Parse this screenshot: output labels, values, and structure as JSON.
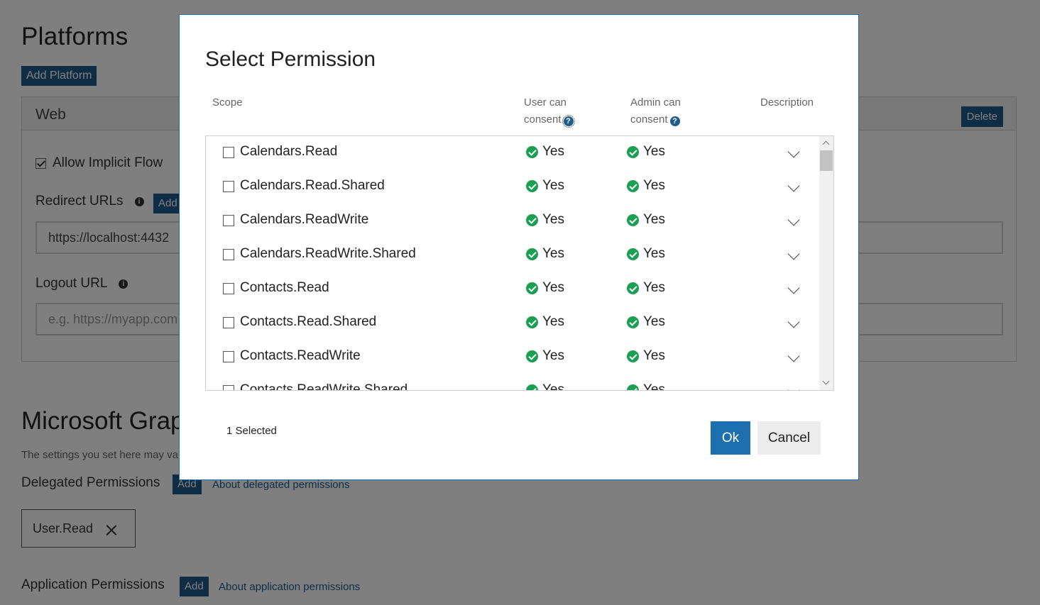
{
  "background": {
    "platforms_title": "Platforms",
    "add_platform_label": "Add Platform",
    "web": {
      "title": "Web",
      "delete_label": "Delete",
      "allow_implicit_label": "Allow Implicit Flow",
      "redirect_label": "Redirect URLs",
      "redirect_add_label": "Add",
      "redirect_value": "https://localhost:4432",
      "logout_label": "Logout URL",
      "logout_placeholder": "e.g. https://myapp.com"
    },
    "graph_title": "Microsoft Graph",
    "graph_note": "The settings you set here may va",
    "delegated_label": "Delegated Permissions",
    "delegated_add_label": "Add",
    "delegated_link": "About delegated permissions",
    "chip_label": "User.Read",
    "application_label": "Application Permissions",
    "application_add_label": "Add",
    "application_link": "About application permissions"
  },
  "modal": {
    "title": "Select Permission",
    "columns": {
      "scope": "Scope",
      "user_line1": "User can",
      "user_line2": "consent",
      "admin_line1": "Admin can",
      "admin_line2": "consent",
      "description": "Description"
    },
    "rows": [
      {
        "scope": "Calendars.Read",
        "user": "Yes",
        "admin": "Yes"
      },
      {
        "scope": "Calendars.Read.Shared",
        "user": "Yes",
        "admin": "Yes"
      },
      {
        "scope": "Calendars.ReadWrite",
        "user": "Yes",
        "admin": "Yes"
      },
      {
        "scope": "Calendars.ReadWrite.Shared",
        "user": "Yes",
        "admin": "Yes"
      },
      {
        "scope": "Contacts.Read",
        "user": "Yes",
        "admin": "Yes"
      },
      {
        "scope": "Contacts.Read.Shared",
        "user": "Yes",
        "admin": "Yes"
      },
      {
        "scope": "Contacts.ReadWrite",
        "user": "Yes",
        "admin": "Yes"
      },
      {
        "scope": "Contacts.ReadWrite.Shared",
        "user": "Yes",
        "admin": "Yes"
      }
    ],
    "selected_count": "1 Selected",
    "ok_label": "Ok",
    "cancel_label": "Cancel"
  },
  "icons": {
    "info": "info-icon",
    "help": "question-icon",
    "check": "green-check-icon",
    "chevron": "chevron-down-icon"
  },
  "colors": {
    "accent": "#1e6fb0",
    "button_dark": "#1e5d8c",
    "success": "#1aa053"
  }
}
